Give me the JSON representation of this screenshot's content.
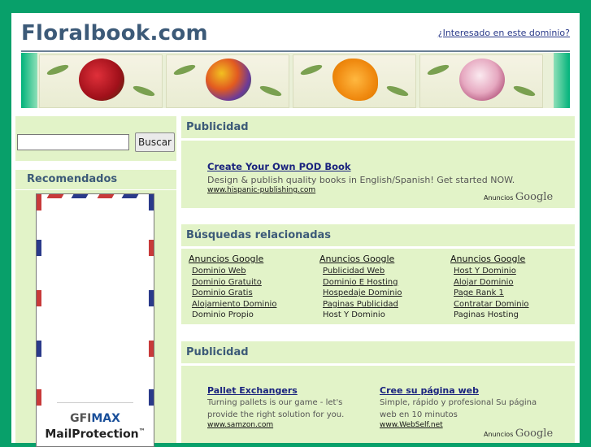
{
  "site": {
    "title": "Floralbook.com",
    "interest_link": "¿Interesado en este dominio?"
  },
  "search": {
    "button_label": "Buscar",
    "value": ""
  },
  "recommended": {
    "heading": "Recomendados",
    "ad_brand_gfi": "GFI",
    "ad_brand_max": "MAX",
    "ad_product": "MailProtection",
    "ad_tm": "™"
  },
  "publicidad_top": {
    "heading": "Publicidad",
    "ads": [
      {
        "title": "Create Your Own POD Book",
        "description": "Design & publish quality books in English/Spanish! Get started NOW.",
        "url": "www.hispanic-publishing.com"
      }
    ],
    "brand_small": "Anuncios",
    "brand_big": "Google"
  },
  "related": {
    "heading": "Búsquedas relacionadas",
    "columns": [
      {
        "header": "Anuncios Google",
        "items": [
          "Dominio Web",
          "Dominio Gratuito",
          "Dominio Gratis",
          "Alojamiento Dominio",
          "Dominio Propio"
        ]
      },
      {
        "header": "Anuncios Google",
        "items": [
          "Publicidad Web",
          "Dominio E Hosting",
          "Hospedaje Dominio",
          "Paginas Publicidad",
          "Host Y Dominio"
        ]
      },
      {
        "header": "Anuncios Google",
        "items": [
          "Host Y Dominio",
          "Alojar Dominio",
          "Page Rank 1",
          "Contratar Dominio",
          "Paginas Hosting"
        ]
      }
    ]
  },
  "publicidad_bottom": {
    "heading": "Publicidad",
    "ads": [
      {
        "title": "Pallet Exchangers",
        "description": "Turning pallets is our game - let's provide the right solution for you.",
        "url": "www.samzon.com"
      },
      {
        "title": "Cree su página web",
        "description": "Simple, rápido y profesional Su página web en 10 minutos",
        "url": "www.WebSelf.net"
      }
    ],
    "brand_small": "Anuncios",
    "brand_big": "Google"
  },
  "colors": {
    "frame": "#08a06a",
    "panel": "#e2f3c8",
    "heading": "#3c5a78",
    "link": "#1a237e"
  }
}
